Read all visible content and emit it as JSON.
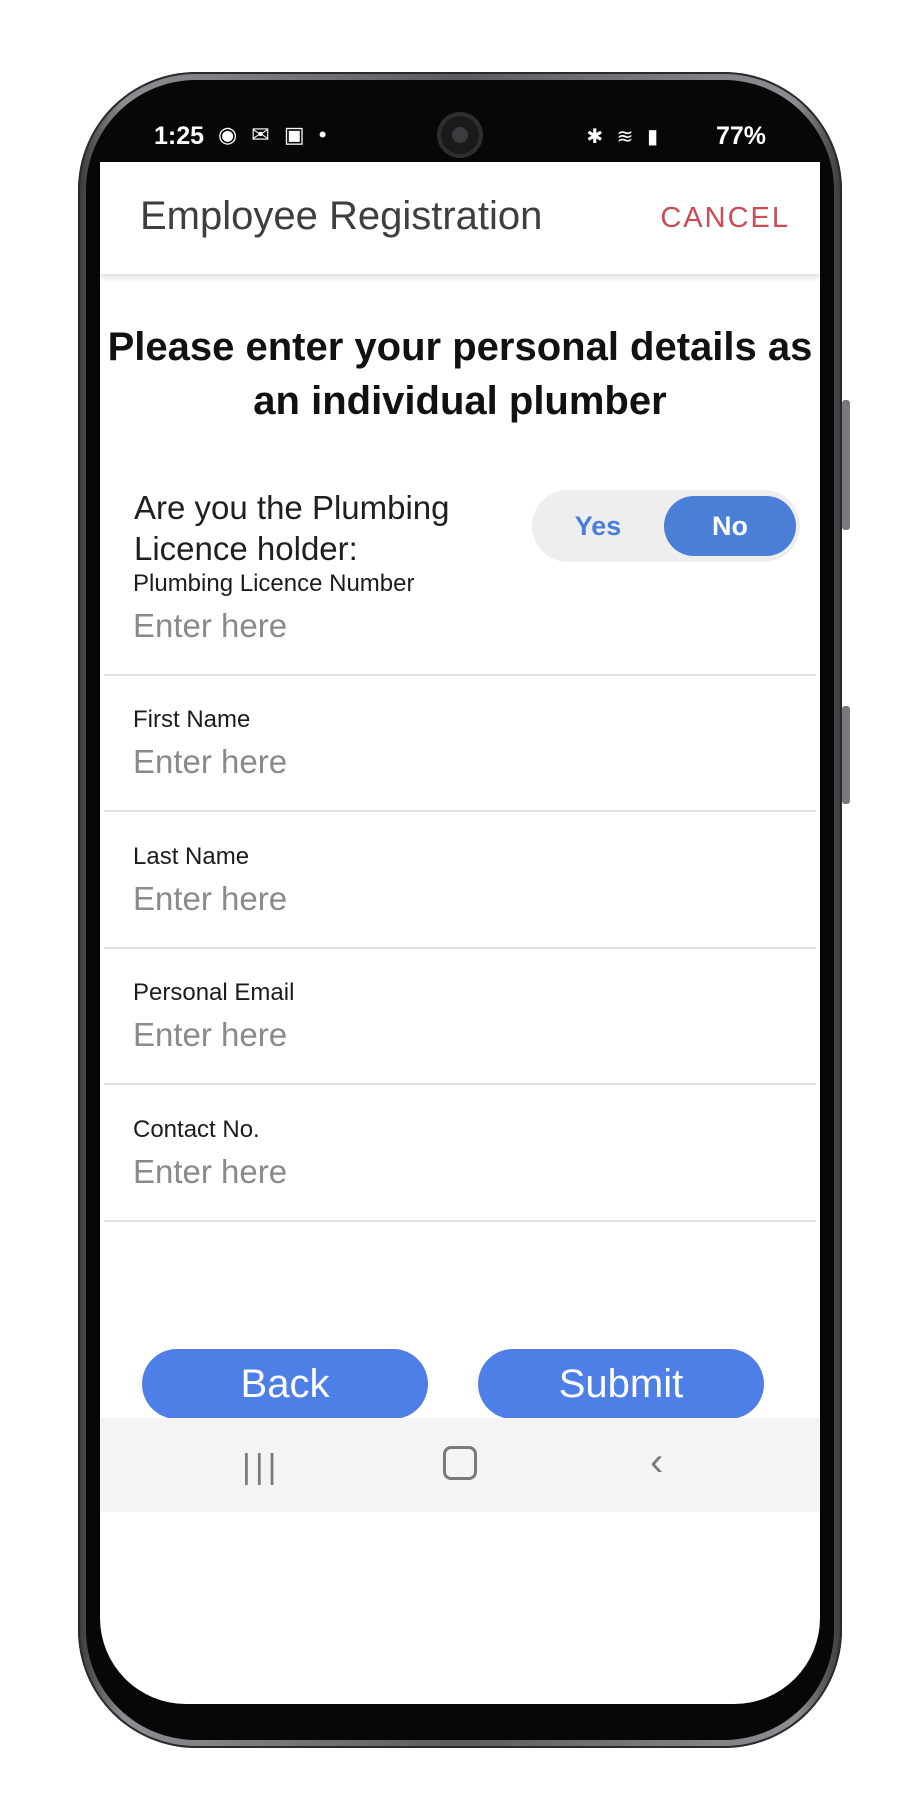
{
  "status_bar": {
    "time": "1:25",
    "notification_icons": "◉ ✉ ▣ •",
    "system_icons": "✱ ≋ ▮",
    "battery": "77%"
  },
  "app_bar": {
    "title": "Employee Registration",
    "cancel_label": "CANCEL"
  },
  "heading": "Please enter your personal details as an individual plumber",
  "licence_question": {
    "label": "Are you the Plumbing Licence holder:",
    "options": [
      "Yes",
      "No"
    ],
    "selected": "No"
  },
  "fields": [
    {
      "label": "Plumbing Licence Number",
      "placeholder": "Enter here",
      "value": ""
    },
    {
      "label": "First Name",
      "placeholder": "Enter here",
      "value": ""
    },
    {
      "label": "Last Name",
      "placeholder": "Enter here",
      "value": ""
    },
    {
      "label": "Personal Email",
      "placeholder": "Enter here",
      "value": ""
    },
    {
      "label": "Contact No.",
      "placeholder": "Enter here",
      "value": ""
    }
  ],
  "buttons": {
    "back_label": "Back",
    "submit_label": "Submit"
  },
  "nav_bar": {
    "recent_icon": "|||",
    "back_icon": "‹"
  },
  "colors": {
    "accent": "#4e7fe6",
    "cancel": "#cc4b57"
  }
}
